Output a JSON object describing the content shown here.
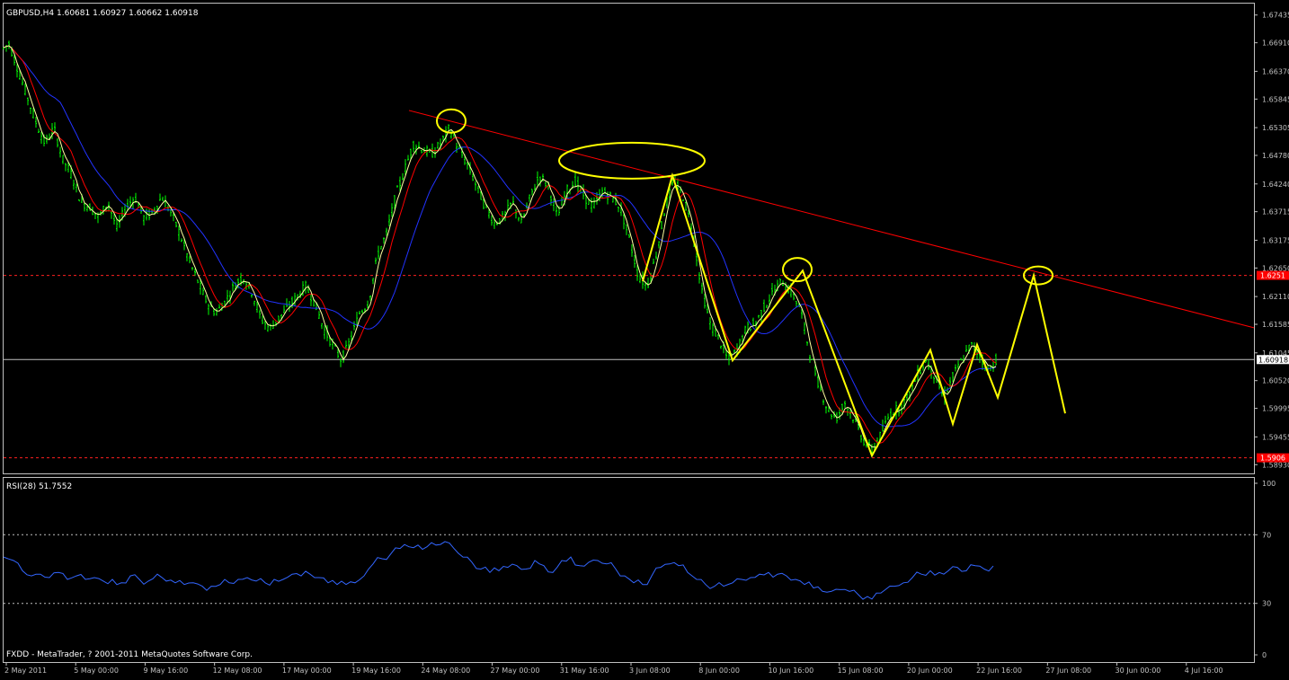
{
  "header": {
    "symbol_line": "GBPUSD,H4  1.60681 1.60927 1.60662 1.60918"
  },
  "indicator": {
    "label": "RSI(28) 51.7552"
  },
  "footer": {
    "copyright": "FXDD - MetaTrader, ? 2001-2011 MetaQuotes Software Corp."
  },
  "colors": {
    "background": "#000000",
    "frame": "#c0c0c0",
    "bull_bars": "#00ff00",
    "ma_fast": "#ffffa0",
    "ma_mid": "#ff0000",
    "ma_slow": "#2233ff",
    "rsi_line": "#3366ff",
    "annotation": "#ffff00",
    "trendline": "#ff0000",
    "price_tag_bg": "#ff0000"
  },
  "chart_data": [
    {
      "type": "line",
      "name": "main",
      "ytick_labels": [
        "1.67435",
        "1.66910",
        "1.66370",
        "1.65845",
        "1.65305",
        "1.64780",
        "1.64240",
        "1.63715",
        "1.63175",
        "1.62650",
        "1.62110",
        "1.61585",
        "1.61045",
        "1.60520",
        "1.59995",
        "1.59455",
        "1.58930"
      ],
      "ylim": [
        1.5885,
        1.676
      ],
      "current_price": 1.60918,
      "current_price_label": "1.60918",
      "resistance_level": 1.6251,
      "resistance_label": "1.6251",
      "support_level": 1.5906,
      "support_label": "1.5906",
      "x_labels": [
        "2 May 2011",
        "5 May 00:00",
        "9 May 16:00",
        "12 May 08:00",
        "17 May 00:00",
        "19 May 16:00",
        "24 May 08:00",
        "27 May 00:00",
        "31 May 16:00",
        "3 Jun 08:00",
        "8 Jun 00:00",
        "10 Jun 16:00",
        "15 Jun 08:00",
        "20 Jun 00:00",
        "22 Jun 16:00",
        "27 Jun 08:00",
        "30 Jun 00:00",
        "4 Jul 16:00"
      ],
      "price_path": [
        [
          0,
          1.6675
        ],
        [
          10,
          1.669
        ],
        [
          20,
          1.664
        ],
        [
          30,
          1.659
        ],
        [
          40,
          1.654
        ],
        [
          50,
          1.65
        ],
        [
          60,
          1.653
        ],
        [
          70,
          1.647
        ],
        [
          80,
          1.644
        ],
        [
          90,
          1.639
        ],
        [
          100,
          1.638
        ],
        [
          110,
          1.636
        ],
        [
          120,
          1.639
        ],
        [
          130,
          1.634
        ],
        [
          140,
          1.638
        ],
        [
          150,
          1.64
        ],
        [
          160,
          1.636
        ],
        [
          170,
          1.637
        ],
        [
          180,
          1.64
        ],
        [
          190,
          1.637
        ],
        [
          200,
          1.633
        ],
        [
          210,
          1.628
        ],
        [
          220,
          1.624
        ],
        [
          230,
          1.62
        ],
        [
          240,
          1.618
        ],
        [
          250,
          1.62
        ],
        [
          260,
          1.623
        ],
        [
          270,
          1.625
        ],
        [
          280,
          1.622
        ],
        [
          290,
          1.617
        ],
        [
          300,
          1.615
        ],
        [
          310,
          1.617
        ],
        [
          320,
          1.619
        ],
        [
          330,
          1.621
        ],
        [
          340,
          1.623
        ],
        [
          350,
          1.62
        ],
        [
          360,
          1.615
        ],
        [
          370,
          1.612
        ],
        [
          380,
          1.609
        ],
        [
          390,
          1.613
        ],
        [
          400,
          1.618
        ],
        [
          410,
          1.62
        ],
        [
          420,
          1.629
        ],
        [
          430,
          1.633
        ],
        [
          440,
          1.64
        ],
        [
          450,
          1.645
        ],
        [
          460,
          1.65
        ],
        [
          470,
          1.649
        ],
        [
          480,
          1.648
        ],
        [
          490,
          1.65
        ],
        [
          500,
          1.653
        ],
        [
          510,
          1.649
        ],
        [
          520,
          1.646
        ],
        [
          530,
          1.642
        ],
        [
          540,
          1.638
        ],
        [
          550,
          1.635
        ],
        [
          560,
          1.636
        ],
        [
          570,
          1.639
        ],
        [
          580,
          1.635
        ],
        [
          590,
          1.64
        ],
        [
          600,
          1.644
        ],
        [
          610,
          1.642
        ],
        [
          620,
          1.636
        ],
        [
          630,
          1.641
        ],
        [
          640,
          1.643
        ],
        [
          650,
          1.64
        ],
        [
          660,
          1.638
        ],
        [
          670,
          1.641
        ],
        [
          680,
          1.64
        ],
        [
          690,
          1.638
        ],
        [
          700,
          1.632
        ],
        [
          710,
          1.625
        ],
        [
          720,
          1.623
        ],
        [
          730,
          1.629
        ],
        [
          740,
          1.638
        ],
        [
          750,
          1.643
        ],
        [
          760,
          1.64
        ],
        [
          770,
          1.634
        ],
        [
          780,
          1.623
        ],
        [
          790,
          1.616
        ],
        [
          800,
          1.613
        ],
        [
          810,
          1.609
        ],
        [
          820,
          1.611
        ],
        [
          830,
          1.615
        ],
        [
          840,
          1.616
        ],
        [
          850,
          1.619
        ],
        [
          860,
          1.622
        ],
        [
          870,
          1.624
        ],
        [
          880,
          1.622
        ],
        [
          890,
          1.619
        ],
        [
          900,
          1.611
        ],
        [
          910,
          1.605
        ],
        [
          920,
          1.6
        ],
        [
          930,
          1.598
        ],
        [
          940,
          1.601
        ],
        [
          950,
          1.598
        ],
        [
          960,
          1.594
        ],
        [
          970,
          1.592
        ],
        [
          980,
          1.595
        ],
        [
          990,
          1.599
        ],
        [
          1000,
          1.6
        ],
        [
          1010,
          1.602
        ],
        [
          1020,
          1.606
        ],
        [
          1030,
          1.609
        ],
        [
          1040,
          1.606
        ],
        [
          1050,
          1.602
        ],
        [
          1060,
          1.606
        ],
        [
          1070,
          1.609
        ],
        [
          1080,
          1.612
        ],
        [
          1090,
          1.61
        ],
        [
          1100,
          1.607
        ],
        [
          1108,
          1.60918
        ]
      ],
      "drawings": {
        "trendline": [
          [
            455,
            1.6563
          ],
          [
            1395,
            1.6152
          ]
        ],
        "zigzag_1": [
          [
            715,
            1.624
          ],
          [
            748,
            1.644
          ],
          [
            815,
            1.609
          ],
          [
            893,
            1.626
          ],
          [
            970,
            1.591
          ],
          [
            1035,
            1.611
          ],
          [
            1060,
            1.597
          ],
          [
            1087,
            1.612
          ],
          [
            1110,
            1.602
          ],
          [
            1150,
            1.6251
          ],
          [
            1185,
            1.599
          ]
        ],
        "ellipses": [
          {
            "cx": 502,
            "price": 1.6543,
            "rx": 16,
            "ry": 13
          },
          {
            "cx": 703,
            "price": 1.6468,
            "rx": 81,
            "ry": 20
          },
          {
            "cx": 887,
            "price": 1.6262,
            "rx": 16,
            "ry": 13
          },
          {
            "cx": 1155,
            "price": 1.6251,
            "rx": 16,
            "ry": 10
          }
        ]
      }
    },
    {
      "type": "line",
      "name": "RSI(28)",
      "ylim": [
        0,
        100
      ],
      "ytick_labels": [
        "100",
        "70",
        "30",
        "0"
      ],
      "levels": [
        70,
        30
      ],
      "values": [
        [
          4,
          57
        ],
        [
          15,
          55
        ],
        [
          25,
          49
        ],
        [
          35,
          46
        ],
        [
          45,
          47
        ],
        [
          55,
          45
        ],
        [
          65,
          48
        ],
        [
          75,
          44
        ],
        [
          85,
          46
        ],
        [
          95,
          44
        ],
        [
          105,
          45
        ],
        [
          115,
          43
        ],
        [
          125,
          44
        ],
        [
          135,
          42
        ],
        [
          145,
          46
        ],
        [
          155,
          44
        ],
        [
          165,
          43
        ],
        [
          175,
          47
        ],
        [
          185,
          43
        ],
        [
          195,
          42
        ],
        [
          205,
          41
        ],
        [
          215,
          42
        ],
        [
          225,
          40
        ],
        [
          235,
          40
        ],
        [
          245,
          41
        ],
        [
          255,
          42
        ],
        [
          265,
          44
        ],
        [
          275,
          45
        ],
        [
          285,
          43
        ],
        [
          295,
          42
        ],
        [
          305,
          44
        ],
        [
          315,
          44
        ],
        [
          325,
          47
        ],
        [
          335,
          46
        ],
        [
          345,
          47
        ],
        [
          355,
          45
        ],
        [
          365,
          42
        ],
        [
          375,
          41
        ],
        [
          385,
          41
        ],
        [
          395,
          42
        ],
        [
          405,
          46
        ],
        [
          415,
          53
        ],
        [
          425,
          56
        ],
        [
          435,
          59
        ],
        [
          445,
          62
        ],
        [
          455,
          63
        ],
        [
          465,
          64
        ],
        [
          475,
          63
        ],
        [
          485,
          64
        ],
        [
          495,
          66
        ],
        [
          505,
          62
        ],
        [
          515,
          57
        ],
        [
          525,
          54
        ],
        [
          535,
          50
        ],
        [
          545,
          48
        ],
        [
          555,
          49
        ],
        [
          565,
          51
        ],
        [
          575,
          52
        ],
        [
          585,
          50
        ],
        [
          595,
          55
        ],
        [
          605,
          52
        ],
        [
          615,
          48
        ],
        [
          625,
          55
        ],
        [
          635,
          57
        ],
        [
          645,
          52
        ],
        [
          655,
          54
        ],
        [
          665,
          55
        ],
        [
          675,
          53
        ],
        [
          685,
          50
        ],
        [
          695,
          46
        ],
        [
          705,
          42
        ],
        [
          715,
          41
        ],
        [
          725,
          46
        ],
        [
          735,
          51
        ],
        [
          745,
          53
        ],
        [
          755,
          52
        ],
        [
          765,
          48
        ],
        [
          775,
          44
        ],
        [
          785,
          41
        ],
        [
          795,
          40
        ],
        [
          805,
          40
        ],
        [
          815,
          42
        ],
        [
          825,
          44
        ],
        [
          835,
          45
        ],
        [
          845,
          47
        ],
        [
          855,
          48
        ],
        [
          865,
          47
        ],
        [
          875,
          46
        ],
        [
          885,
          44
        ],
        [
          895,
          41
        ],
        [
          905,
          39
        ],
        [
          915,
          37
        ],
        [
          925,
          37
        ],
        [
          935,
          38
        ],
        [
          945,
          37
        ],
        [
          955,
          35
        ],
        [
          965,
          34
        ],
        [
          975,
          36
        ],
        [
          985,
          38
        ],
        [
          995,
          40
        ],
        [
          1005,
          42
        ],
        [
          1015,
          45
        ],
        [
          1025,
          47
        ],
        [
          1035,
          49
        ],
        [
          1045,
          48
        ],
        [
          1055,
          49
        ],
        [
          1065,
          51
        ],
        [
          1075,
          49
        ],
        [
          1085,
          52
        ],
        [
          1095,
          50
        ],
        [
          1105,
          51.7552
        ]
      ]
    }
  ]
}
